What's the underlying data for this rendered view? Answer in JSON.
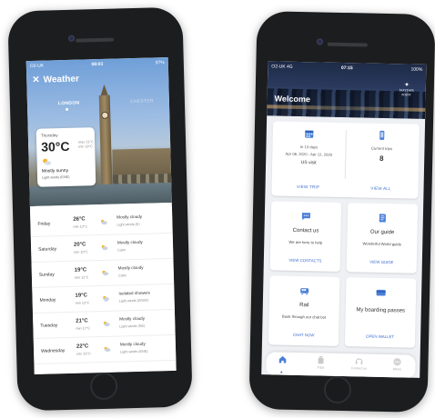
{
  "weather_app": {
    "status": {
      "carrier": "O2-UK",
      "time": "08:03",
      "battery": "97%"
    },
    "title": "Weather",
    "cities": [
      "LONDON",
      "CHESTER"
    ],
    "today": {
      "day": "Thursday",
      "temp": "30°C",
      "max": "max 31°C",
      "min": "min 19°C",
      "condition": "Mostly sunny",
      "wind": "Light winds (ENE)"
    },
    "forecast": [
      {
        "day": "Friday",
        "temp": "26°C",
        "min": "min 13°C",
        "condition": "Mostly cloudy",
        "wind": "Light winds (E)"
      },
      {
        "day": "Saturday",
        "temp": "20°C",
        "min": "min 10°C",
        "condition": "Mostly cloudy",
        "wind": "Calm"
      },
      {
        "day": "Sunday",
        "temp": "19°C",
        "min": "min 11°C",
        "condition": "Mostly cloudy",
        "wind": "Calm"
      },
      {
        "day": "Monday",
        "temp": "19°C",
        "min": "min 13°C",
        "condition": "Isolated showers",
        "wind": "Light winds (WSW)"
      },
      {
        "day": "Tuesday",
        "temp": "21°C",
        "min": "min 17°C",
        "condition": "Mostly cloudy",
        "wind": "Light winds (NE)"
      },
      {
        "day": "Wednesday",
        "temp": "22°C",
        "min": "min 15°C",
        "condition": "Mostly cloudy",
        "wind": "Light winds (ENE)"
      }
    ]
  },
  "travel_app": {
    "status": {
      "carrier": "O2-UK 4G",
      "time": "07:15",
      "battery": "100%"
    },
    "welcome": "Welcome",
    "logo": {
      "line1": "MAYFAIR",
      "line2": "POINT"
    },
    "trip": {
      "days": "In 13 days",
      "dates": "Apr 06, 2020 - Apr 12, 2020",
      "place": "US visit",
      "action": "VIEW TRIP"
    },
    "current": {
      "label": "Current trips",
      "count": "8",
      "action": "VIEW ALL"
    },
    "contact": {
      "title": "Contact us",
      "subtitle": "We are here to help",
      "action": "VIEW CONTACTS"
    },
    "guide": {
      "title": "Our guide",
      "subtitle": "Wonderful World guide",
      "action": "VIEW GUIDE"
    },
    "rail": {
      "title": "Rail",
      "subtitle": "Book through our chat bot",
      "action": "CHAT NOW"
    },
    "boarding": {
      "title": "My boarding passes",
      "action": "OPEN WALLET"
    },
    "nav": [
      "",
      "Trips",
      "Contact us",
      "Menu"
    ]
  },
  "colors": {
    "accent": "#3d6fd0",
    "icon_blue": "#4a7fd8"
  }
}
